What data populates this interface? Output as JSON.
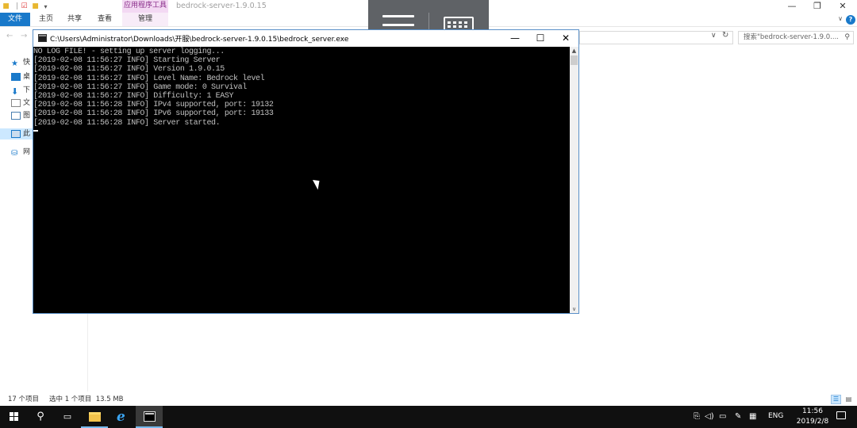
{
  "explorer": {
    "window_title": "bedrock-server-1.9.0.15",
    "context_tab": "应用程序工具",
    "ribbon_tabs": [
      "文件",
      "主页",
      "共享",
      "查看",
      "管理"
    ],
    "search_placeholder": "搜索\"bedrock-server-1.9.0....",
    "nav_items": [
      "快",
      "桌",
      "下",
      "文",
      "图",
      "此",
      "网"
    ],
    "status": {
      "item_count": "17 个项目",
      "selected": "选中 1 个项目  13.5 MB"
    }
  },
  "console": {
    "title": "C:\\Users\\Administrator\\Downloads\\开服\\bedrock-server-1.9.0.15\\bedrock_server.exe",
    "lines": [
      "NO LOG FILE! - setting up server logging...",
      "[2019-02-08 11:56:27 INFO] Starting Server",
      "[2019-02-08 11:56:27 INFO] Version 1.9.0.15",
      "[2019-02-08 11:56:27 INFO] Level Name: Bedrock level",
      "[2019-02-08 11:56:27 INFO] Game mode: 0 Survival",
      "[2019-02-08 11:56:27 INFO] Difficulty: 1 EASY",
      "[2019-02-08 11:56:28 INFO] IPv4 supported, port: 19132",
      "[2019-02-08 11:56:28 INFO] IPv6 supported, port: 19133",
      "[2019-02-08 11:56:28 INFO] Server started."
    ]
  },
  "taskbar": {
    "language": "ENG",
    "time": "11:56",
    "date": "2019/2/8"
  },
  "colors": {
    "accent": "#1979ca",
    "console_bg": "#000000",
    "console_text": "#c0c0c0",
    "taskbar_bg": "#101010",
    "remote_bar": "#5f6266"
  }
}
